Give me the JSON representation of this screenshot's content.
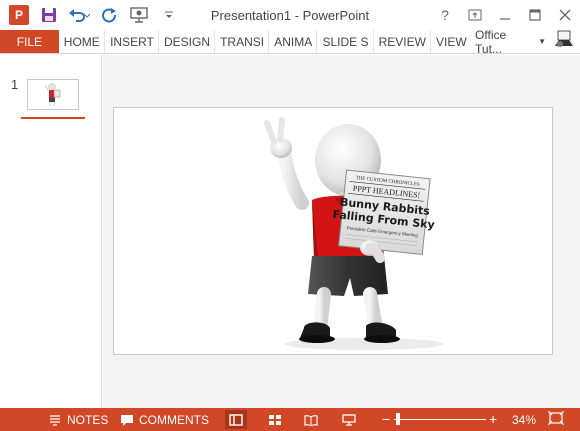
{
  "window": {
    "title": "Presentation1 - PowerPoint",
    "app_logo_letter": "P",
    "controls": [
      "?",
      "restore-ribbon",
      "minimize",
      "maximize",
      "close"
    ]
  },
  "ribbon": {
    "file_tab": "FILE",
    "tabs": [
      "HOME",
      "INSERT",
      "DESIGN",
      "TRANSI",
      "ANIMA",
      "SLIDE S",
      "REVIEW",
      "VIEW"
    ],
    "account_name": "Office Tut..."
  },
  "thumbnails": {
    "slide_number": "1"
  },
  "slide": {
    "newspaper": {
      "masthead": "THE CUSTOM CHRONICLES",
      "section": "PPPT HEADLINES!",
      "headline_line1": "Bunny Rabbits",
      "headline_line2": "Falling From Sky",
      "subline": "President Calls Emergency Meeting"
    }
  },
  "statusbar": {
    "notes_label": "NOTES",
    "comments_label": "COMMENTS",
    "zoom_level": "34%",
    "zoom_fraction": 0.34
  },
  "colors": {
    "accent": "#d24726",
    "statusbar": "#d24726",
    "editor_bg": "#f3f3f3"
  }
}
